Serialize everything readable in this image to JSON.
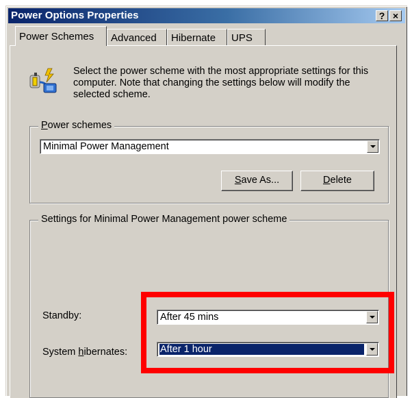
{
  "window": {
    "title": "Power Options Properties",
    "help_label": "?",
    "close_label": "×"
  },
  "tabs": [
    {
      "label": "Power Schemes",
      "active": true
    },
    {
      "label": "Advanced",
      "active": false
    },
    {
      "label": "Hibernate",
      "active": false
    },
    {
      "label": "UPS",
      "active": false
    }
  ],
  "description": "Select the power scheme with the most appropriate settings for this computer. Note that changing the settings below will modify the selected scheme.",
  "power_schemes": {
    "group_label_mnemonic": "P",
    "group_label_rest": "ower schemes",
    "selected": "Minimal Power Management",
    "save_as": {
      "mnemonic": "S",
      "rest": "ave As..."
    },
    "delete": {
      "mnemonic": "D",
      "rest": "elete"
    }
  },
  "settings": {
    "group_label": "Settings for Minimal Power Management power scheme",
    "standby_label": "Standby:",
    "standby_value": "After 45 mins",
    "hibernate_label_pre": "System ",
    "hibernate_label_mnemonic": "h",
    "hibernate_label_post": "ibernates:",
    "hibernate_value": "After 1 hour"
  },
  "colors": {
    "highlight_annotation": "#ff0000",
    "titlebar_start": "#0a246a",
    "selection": "#0a246a"
  }
}
